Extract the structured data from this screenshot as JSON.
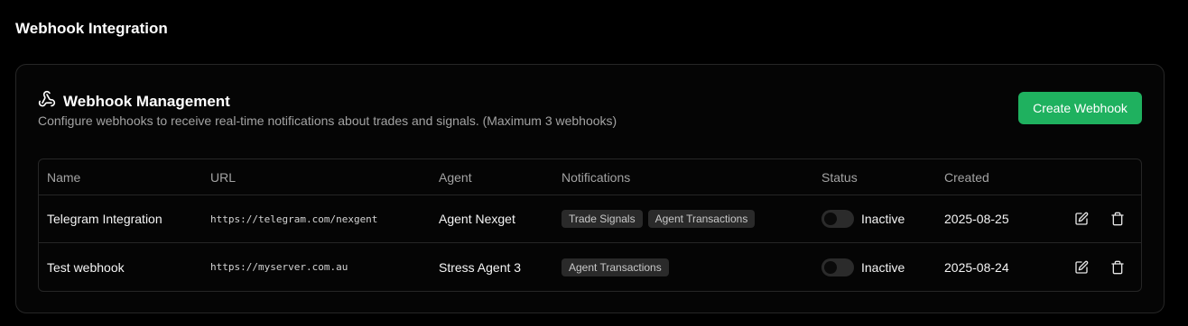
{
  "page": {
    "title": "Webhook Integration"
  },
  "card": {
    "title": "Webhook Management",
    "description": "Configure webhooks to receive real-time notifications about trades and signals. (Maximum 3 webhooks)",
    "create_button": "Create Webhook"
  },
  "colors": {
    "accent": "#1fb15f",
    "background": "#000000",
    "badge": "#2a2a2a"
  },
  "table": {
    "headers": {
      "name": "Name",
      "url": "URL",
      "agent": "Agent",
      "notifications": "Notifications",
      "status": "Status",
      "created": "Created"
    },
    "rows": [
      {
        "name": "Telegram Integration",
        "url": "https://telegram.com/nexgent",
        "agent": "Agent Nexget",
        "notifications": [
          "Trade Signals",
          "Agent Transactions"
        ],
        "status": "Inactive",
        "created": "2025-08-25"
      },
      {
        "name": "Test webhook",
        "url": "https://myserver.com.au",
        "agent": "Stress Agent 3",
        "notifications": [
          "Agent Transactions"
        ],
        "status": "Inactive",
        "created": "2025-08-24"
      }
    ]
  },
  "icons": {
    "card_title": "webhook-icon",
    "edit": "edit-icon",
    "delete": "trash-icon"
  }
}
